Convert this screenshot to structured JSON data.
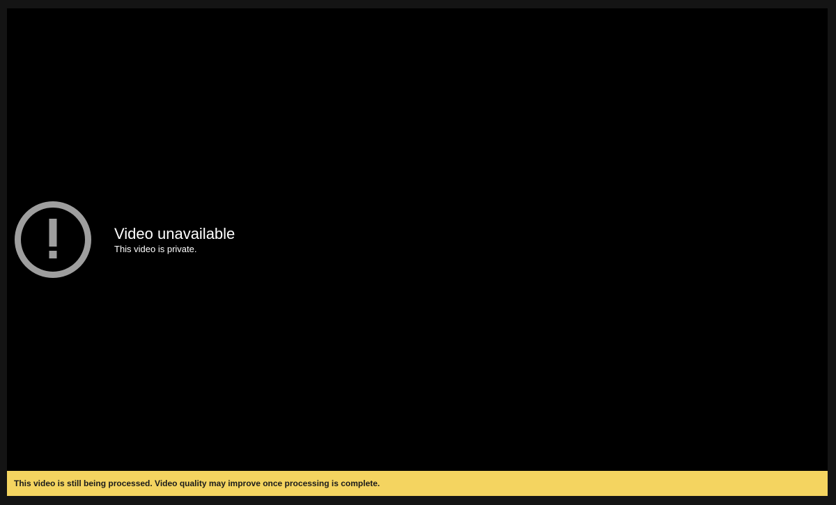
{
  "player": {
    "error": {
      "icon": "exclamation-circle-icon",
      "title": "Video unavailable",
      "subtitle": "This video is private."
    },
    "notice": {
      "text": "This video is still being processed. Video quality may improve once processing is complete."
    }
  },
  "colors": {
    "page_background": "#141414",
    "player_background": "#000000",
    "icon_color": "#9e9e9e",
    "notice_background": "#f4d460",
    "notice_text": "#1a1a1a"
  }
}
